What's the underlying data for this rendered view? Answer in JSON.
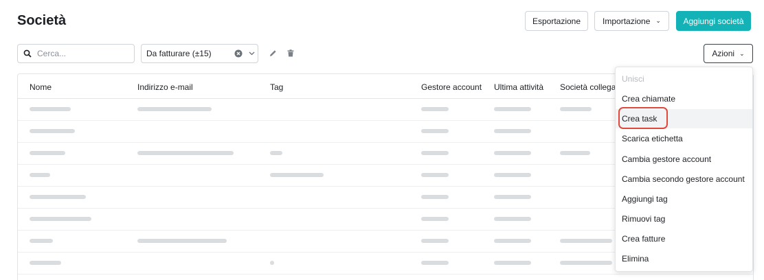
{
  "page": {
    "title": "Società"
  },
  "header": {
    "export_label": "Esportazione",
    "import_label": "Importazione",
    "add_label": "Aggiungi società",
    "accent_color": "#13b2b6"
  },
  "toolbar": {
    "search_placeholder": "Cerca...",
    "filter_value": "Da fatturare (±15)",
    "actions_label": "Azioni",
    "icons": [
      "search-icon",
      "clear-icon",
      "chevron-down-icon",
      "pencil-icon",
      "trash-icon"
    ]
  },
  "table": {
    "columns": [
      "Nome",
      "Indirizzo e-mail",
      "Tag",
      "Gestore account",
      "Ultima attività",
      "Società collega"
    ],
    "rows_note_blurred": true
  },
  "actions_menu": {
    "items": [
      {
        "label": "Unisci",
        "state": "disabled"
      },
      {
        "label": "Crea chiamate",
        "state": "normal"
      },
      {
        "label": "Crea task",
        "state": "highlighted"
      },
      {
        "label": "Scarica etichetta",
        "state": "normal"
      },
      {
        "label": "Cambia gestore account",
        "state": "normal"
      },
      {
        "label": "Cambia secondo gestore account",
        "state": "normal"
      },
      {
        "label": "Aggiungi tag",
        "state": "normal"
      },
      {
        "label": "Rimuovi tag",
        "state": "normal"
      },
      {
        "label": "Crea fatture",
        "state": "normal"
      },
      {
        "label": "Elimina",
        "state": "normal"
      }
    ],
    "highlight_color": "#e0483b"
  }
}
